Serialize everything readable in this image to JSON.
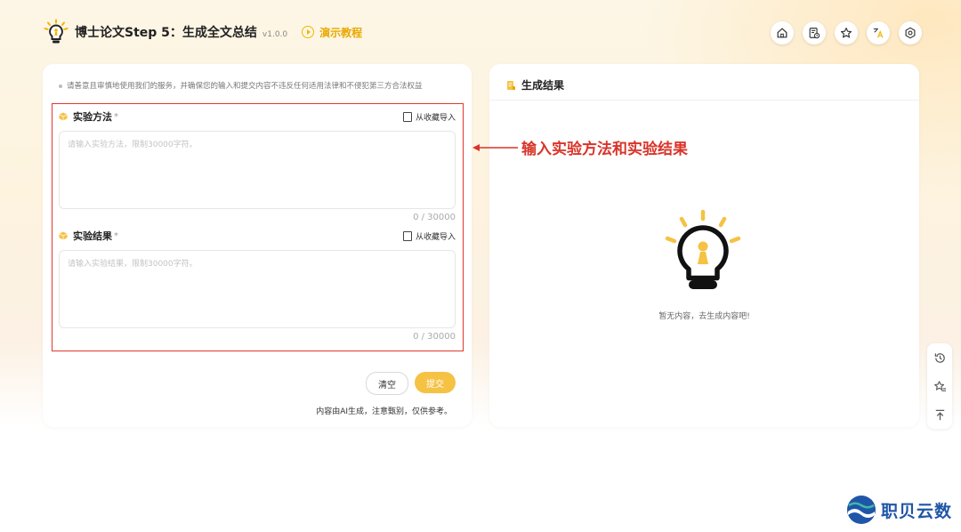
{
  "header": {
    "title": "博士论文Step 5：生成全文总结",
    "version": "v1.0.0",
    "demo_label": "演示教程"
  },
  "toolbar": {
    "icons": [
      "home-icon",
      "history-doc-icon",
      "star-icon",
      "translate-icon",
      "settings-icon"
    ]
  },
  "notice": "请善意且审慎地使用我们的服务，并确保您的输入和提交内容不违反任何适用法律和不侵犯第三方合法权益",
  "fields": [
    {
      "label": "实验方法",
      "required_mark": "*",
      "import_label": "从收藏导入",
      "placeholder": "请输入实验方法，限制30000字符。",
      "counter": "0 / 30000"
    },
    {
      "label": "实验结果",
      "required_mark": "*",
      "import_label": "从收藏导入",
      "placeholder": "请输入实验结果，限制30000字符。",
      "counter": "0 / 30000"
    }
  ],
  "actions": {
    "clear_label": "清空",
    "submit_label": "提交",
    "disclaimer": "内容由AI生成，注意甄别，仅供参考。"
  },
  "result": {
    "title": "生成结果",
    "empty_text": "暂无内容，去生成内容吧!"
  },
  "annotation": {
    "text": "输入实验方法和实验结果",
    "color": "#d9342a"
  },
  "watermark": {
    "text": "职贝云数"
  },
  "colors": {
    "accent": "#f5c244",
    "annotation_red": "#e0392b"
  }
}
